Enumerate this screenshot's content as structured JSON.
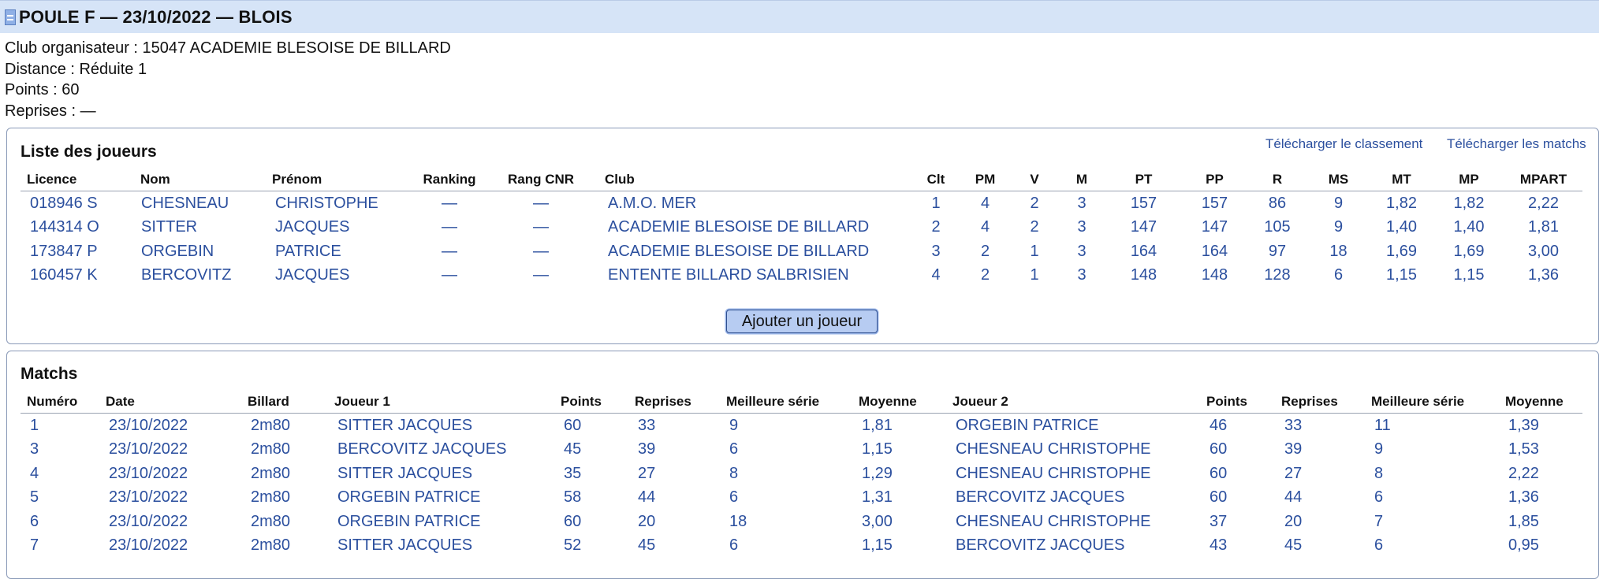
{
  "header": {
    "title": "POULE F — 23/10/2022 — BLOIS"
  },
  "info": {
    "club": "Club organisateur : 15047 ACADEMIE BLESOISE DE BILLARD",
    "distance": "Distance : Réduite 1",
    "points": "Points : 60",
    "reprises": "Reprises : —"
  },
  "players": {
    "title": "Liste des joueurs",
    "download_ranking": "Télécharger le classement",
    "download_matches": "Télécharger les matchs",
    "add_button": "Ajouter un joueur",
    "columns": [
      "Licence",
      "Nom",
      "Prénom",
      "Ranking",
      "Rang CNR",
      "Club",
      "Clt",
      "PM",
      "V",
      "M",
      "PT",
      "PP",
      "R",
      "MS",
      "MT",
      "MP",
      "MPART"
    ],
    "rows": [
      [
        "018946 S",
        "CHESNEAU",
        "CHRISTOPHE",
        "—",
        "—",
        "A.M.O. MER",
        "1",
        "4",
        "2",
        "3",
        "157",
        "157",
        "86",
        "9",
        "1,82",
        "1,82",
        "2,22"
      ],
      [
        "144314 O",
        "SITTER",
        "JACQUES",
        "—",
        "—",
        "ACADEMIE BLESOISE DE BILLARD",
        "2",
        "4",
        "2",
        "3",
        "147",
        "147",
        "105",
        "9",
        "1,40",
        "1,40",
        "1,81"
      ],
      [
        "173847 P",
        "ORGEBIN",
        "PATRICE",
        "—",
        "—",
        "ACADEMIE BLESOISE DE BILLARD",
        "3",
        "2",
        "1",
        "3",
        "164",
        "164",
        "97",
        "18",
        "1,69",
        "1,69",
        "3,00"
      ],
      [
        "160457 K",
        "BERCOVITZ",
        "JACQUES",
        "—",
        "—",
        "ENTENTE BILLARD SALBRISIEN",
        "4",
        "2",
        "1",
        "3",
        "148",
        "148",
        "128",
        "6",
        "1,15",
        "1,15",
        "1,36"
      ]
    ]
  },
  "matches": {
    "title": "Matchs",
    "columns": [
      "Numéro",
      "Date",
      "Billard",
      "Joueur 1",
      "Points",
      "Reprises",
      "Meilleure série",
      "Moyenne",
      "Joueur 2",
      "Points",
      "Reprises",
      "Meilleure série",
      "Moyenne"
    ],
    "rows": [
      [
        "1",
        "23/10/2022",
        "2m80",
        "SITTER JACQUES",
        "60",
        "33",
        "9",
        "1,81",
        "ORGEBIN PATRICE",
        "46",
        "33",
        "11",
        "1,39"
      ],
      [
        "3",
        "23/10/2022",
        "2m80",
        "BERCOVITZ JACQUES",
        "45",
        "39",
        "6",
        "1,15",
        "CHESNEAU CHRISTOPHE",
        "60",
        "39",
        "9",
        "1,53"
      ],
      [
        "4",
        "23/10/2022",
        "2m80",
        "SITTER JACQUES",
        "35",
        "27",
        "8",
        "1,29",
        "CHESNEAU CHRISTOPHE",
        "60",
        "27",
        "8",
        "2,22"
      ],
      [
        "5",
        "23/10/2022",
        "2m80",
        "ORGEBIN PATRICE",
        "58",
        "44",
        "6",
        "1,31",
        "BERCOVITZ JACQUES",
        "60",
        "44",
        "6",
        "1,36"
      ],
      [
        "6",
        "23/10/2022",
        "2m80",
        "ORGEBIN PATRICE",
        "60",
        "20",
        "18",
        "3,00",
        "CHESNEAU CHRISTOPHE",
        "37",
        "20",
        "7",
        "1,85"
      ],
      [
        "7",
        "23/10/2022",
        "2m80",
        "SITTER JACQUES",
        "52",
        "45",
        "6",
        "1,15",
        "BERCOVITZ JACQUES",
        "43",
        "45",
        "6",
        "0,95"
      ]
    ]
  }
}
